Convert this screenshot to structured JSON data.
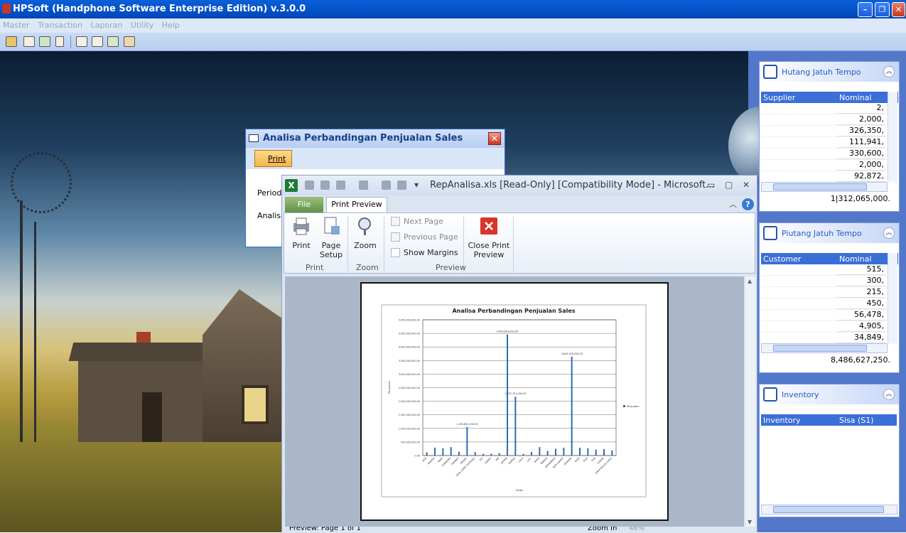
{
  "app": {
    "title": "HPSoft (Handphone Software Enterprise Edition) v.3.0.0"
  },
  "menu": [
    "Master",
    "Transaction",
    "Laporan",
    "Utility",
    "Help"
  ],
  "panels": {
    "hutang": {
      "title": "Hutang Jatuh Tempo",
      "columns": [
        "Supplier",
        "Nominal"
      ],
      "rows": [
        "2,",
        "2,000,",
        "326,350,",
        "111,941,",
        "330,600,",
        "2,000,",
        "92,872,"
      ],
      "total": "1|312,065,000."
    },
    "piutang": {
      "title": "Piutang Jatuh Tempo",
      "columns": [
        "Customer",
        "Nominal"
      ],
      "rows": [
        "515,",
        "300,",
        "215,",
        "450,",
        "56,478,",
        "4,905,",
        "34,849,"
      ],
      "total": "8,486,627,250."
    },
    "inventory": {
      "title": "Inventory",
      "columns": [
        "Inventory",
        "Sisa (S1)"
      ]
    }
  },
  "dialog": {
    "title": "Analisa Perbandingan Penjualan Sales",
    "print_label": "Print",
    "periode_label": "Periode",
    "analisa_label": "Analisa"
  },
  "excel": {
    "title": "RepAnalisa.xls  [Read-Only]  [Compatibility Mode]  -  Microsoft...",
    "tabs": {
      "file": "File",
      "print_preview": "Print Preview"
    },
    "ribbon": {
      "print": "Print",
      "page_setup_1": "Page",
      "page_setup_2": "Setup",
      "zoom": "Zoom",
      "next_page": "Next Page",
      "previous_page": "Previous Page",
      "show_margins": "Show Margins",
      "close_1": "Close Print",
      "close_2": "Preview",
      "group_print": "Print",
      "group_zoom": "Zoom",
      "group_preview": "Preview"
    },
    "status": {
      "left": "Preview: Page 1 of 1",
      "zoom_in": "Zoom In",
      "zoom_pct": "46%"
    }
  },
  "chart_data": {
    "type": "bar",
    "title": "Analisa Perbandingan Penjualan Sales",
    "xlabel": "Sales",
    "ylabel": "Penjualan",
    "legend": "Penjualan",
    "legend_position": "right",
    "ylim": [
      0,
      5000000000
    ],
    "yticks": [
      "5,000,000,000.00",
      "4,500,000,000.00",
      "4,000,000,000.00",
      "3,500,000,000.00",
      "3,000,000,000.00",
      "2,500,000,000.00",
      "2,000,000,000.00",
      "1,500,000,000.00",
      "1,000,000,000.00",
      "500,000,000.00",
      "0.00"
    ],
    "categories": [
      "ADE",
      "ANGGA",
      "ANDI",
      "CHANDRA",
      "DARWIS",
      "DEDEK",
      "DIVA (SONY EDITION)",
      "EVI",
      "GANDI",
      "IRA",
      "JOHAN",
      "KARDO",
      "LALA",
      "LUCI",
      "MAYA",
      "NANDA",
      "NOVEMBER",
      "NUR HAYATI",
      "REVANA",
      "RIZA",
      "RUD",
      "TITA",
      "YUDHA",
      "ZAKA MULIA (SAU)"
    ],
    "series": [
      {
        "name": "Penjualan",
        "values": [
          120000000,
          290000000,
          270000000,
          310000000,
          140000000,
          1050000000,
          130000000,
          60000000,
          70000000,
          90000000,
          4459693000,
          2167000000,
          60000000,
          130000000,
          310000000,
          170000000,
          250000000,
          290000000,
          3645000000,
          290000000,
          270000000,
          220000000,
          240000000,
          190000000
        ]
      }
    ],
    "data_labels": [
      "1,050,600,250.00",
      "4,459,693,000.00",
      "2,167,151,000.00",
      "3,645,316,200.00"
    ]
  }
}
